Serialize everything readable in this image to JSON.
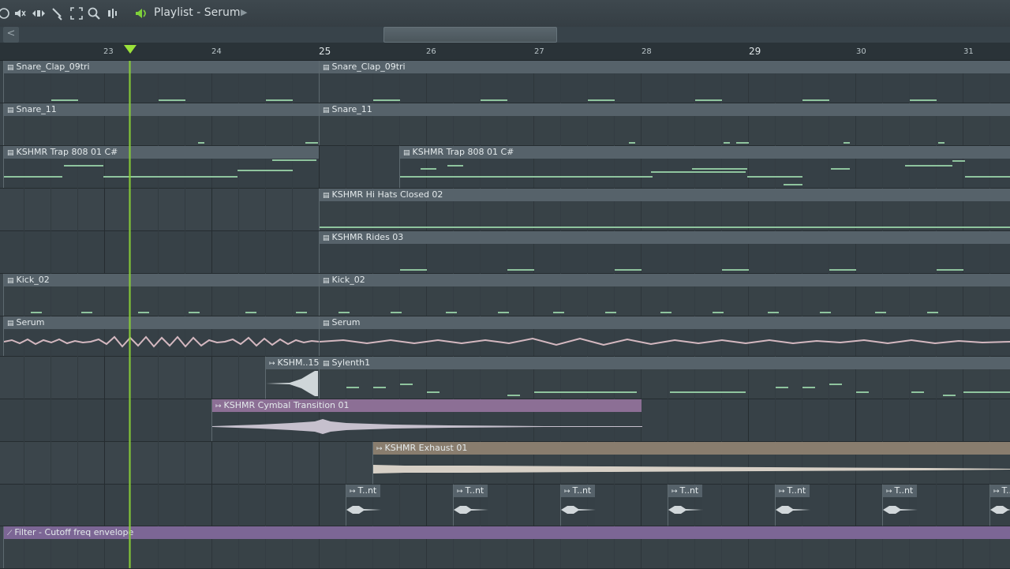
{
  "toolbar": {
    "title": "Playlist - Serum",
    "icons": [
      "menu-icon",
      "mute-icon",
      "slip-icon",
      "slice-icon",
      "select-icon",
      "zoom-icon",
      "playback-icon",
      "speaker-icon"
    ]
  },
  "ruler": {
    "bars": [
      {
        "label": "23",
        "major": false
      },
      {
        "label": "24",
        "major": false
      },
      {
        "label": "25",
        "major": true
      },
      {
        "label": "26",
        "major": false
      },
      {
        "label": "27",
        "major": false
      },
      {
        "label": "28",
        "major": false
      },
      {
        "label": "29",
        "major": true
      },
      {
        "label": "30",
        "major": false
      },
      {
        "label": "31",
        "major": false
      }
    ]
  },
  "clips": [
    {
      "name": "Snare_Clap_09tri",
      "icon": "pattern"
    },
    {
      "name": "Snare_Clap_09tri",
      "icon": "pattern"
    },
    {
      "name": "Snare_11",
      "icon": "pattern"
    },
    {
      "name": "Snare_11",
      "icon": "pattern"
    },
    {
      "name": "KSHMR Trap 808 01 C#",
      "icon": "pattern"
    },
    {
      "name": "KSHMR Trap 808 01 C#",
      "icon": "pattern"
    },
    {
      "name": "KSHMR Hi Hats Closed 02",
      "icon": "pattern"
    },
    {
      "name": "KSHMR Rides 03",
      "icon": "pattern"
    },
    {
      "name": "Kick_02",
      "icon": "pattern"
    },
    {
      "name": "Kick_02",
      "icon": "pattern"
    },
    {
      "name": "Serum",
      "icon": "pattern"
    },
    {
      "name": "Serum",
      "icon": "pattern"
    },
    {
      "name": "KSHM..15",
      "icon": "audio"
    },
    {
      "name": "Sylenth1",
      "icon": "pattern"
    },
    {
      "name": "KSHMR Cymbal Transition 01",
      "icon": "audio"
    },
    {
      "name": "KSHMR Exhaust 01",
      "icon": "audio"
    },
    {
      "name": "T..nt",
      "icon": "audio"
    },
    {
      "name": "T..nt",
      "icon": "audio"
    },
    {
      "name": "T..nt",
      "icon": "audio"
    },
    {
      "name": "T..nt",
      "icon": "audio"
    },
    {
      "name": "T..nt",
      "icon": "audio"
    },
    {
      "name": "T..nt",
      "icon": "audio"
    },
    {
      "name": "T..nt",
      "icon": "audio"
    },
    {
      "name": "Filter - Cutoff freq envelope",
      "icon": "automation"
    }
  ],
  "colors": {
    "playhead": "#8fd43a",
    "note": "#8fc49e",
    "cymbal": "#8c6f95",
    "exhaust": "#897d6e",
    "automation": "#7c6695"
  }
}
